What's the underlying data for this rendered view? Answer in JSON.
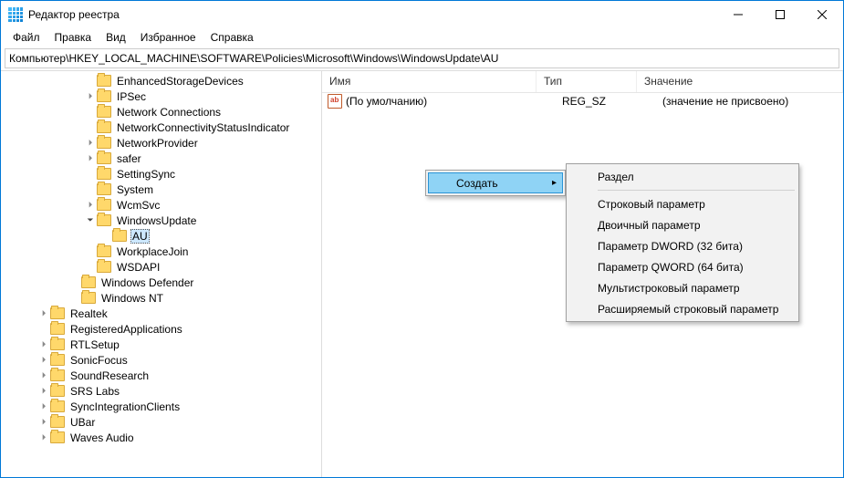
{
  "window": {
    "title": "Редактор реестра"
  },
  "menu": {
    "file": "Файл",
    "edit": "Правка",
    "view": "Вид",
    "favorites": "Избранное",
    "help": "Справка"
  },
  "address": "Компьютер\\HKEY_LOCAL_MACHINE\\SOFTWARE\\Policies\\Microsoft\\Windows\\WindowsUpdate\\AU",
  "tree": [
    {
      "depth": 5,
      "exp": "none",
      "label": "EnhancedStorageDevices"
    },
    {
      "depth": 5,
      "exp": "closed",
      "label": "IPSec"
    },
    {
      "depth": 5,
      "exp": "none",
      "label": "Network Connections"
    },
    {
      "depth": 5,
      "exp": "none",
      "label": "NetworkConnectivityStatusIndicator"
    },
    {
      "depth": 5,
      "exp": "closed",
      "label": "NetworkProvider"
    },
    {
      "depth": 5,
      "exp": "closed",
      "label": "safer"
    },
    {
      "depth": 5,
      "exp": "none",
      "label": "SettingSync"
    },
    {
      "depth": 5,
      "exp": "none",
      "label": "System"
    },
    {
      "depth": 5,
      "exp": "closed",
      "label": "WcmSvc"
    },
    {
      "depth": 5,
      "exp": "open",
      "label": "WindowsUpdate"
    },
    {
      "depth": 6,
      "exp": "none",
      "label": "AU",
      "selected": true
    },
    {
      "depth": 5,
      "exp": "none",
      "label": "WorkplaceJoin"
    },
    {
      "depth": 5,
      "exp": "none",
      "label": "WSDAPI"
    },
    {
      "depth": 4,
      "exp": "none",
      "label": "Windows Defender"
    },
    {
      "depth": 4,
      "exp": "none",
      "label": "Windows NT"
    },
    {
      "depth": 2,
      "exp": "closed",
      "label": "Realtek"
    },
    {
      "depth": 2,
      "exp": "none",
      "label": "RegisteredApplications"
    },
    {
      "depth": 2,
      "exp": "closed",
      "label": "RTLSetup"
    },
    {
      "depth": 2,
      "exp": "closed",
      "label": "SonicFocus"
    },
    {
      "depth": 2,
      "exp": "closed",
      "label": "SoundResearch"
    },
    {
      "depth": 2,
      "exp": "closed",
      "label": "SRS Labs"
    },
    {
      "depth": 2,
      "exp": "closed",
      "label": "SyncIntegrationClients"
    },
    {
      "depth": 2,
      "exp": "closed",
      "label": "UBar"
    },
    {
      "depth": 2,
      "exp": "closed",
      "label": "Waves Audio"
    }
  ],
  "list": {
    "headers": {
      "name": "Имя",
      "type": "Тип",
      "value": "Значение"
    },
    "rows": [
      {
        "name": "(По умолчанию)",
        "type": "REG_SZ",
        "value": "(значение не присвоено)"
      }
    ]
  },
  "context": {
    "create": "Создать",
    "sub": {
      "key": "Раздел",
      "string": "Строковый параметр",
      "binary": "Двоичный параметр",
      "dword": "Параметр DWORD (32 бита)",
      "qword": "Параметр QWORD (64 бита)",
      "multi": "Мультистроковый параметр",
      "expand": "Расширяемый строковый параметр"
    }
  }
}
